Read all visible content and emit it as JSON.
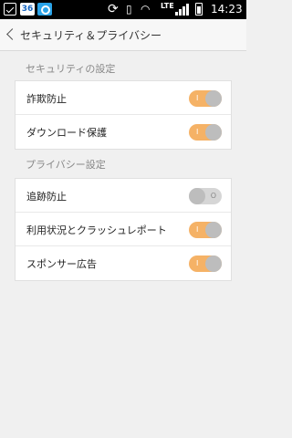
{
  "statusbar": {
    "badge": "36",
    "network": "LTE",
    "time": "14:23"
  },
  "appbar": {
    "title": "セキュリティ＆プライバシー"
  },
  "sections": [
    {
      "header": "セキュリティの設定",
      "items": [
        {
          "label": "詐欺防止",
          "enabled": true
        },
        {
          "label": "ダウンロード保護",
          "enabled": true
        }
      ]
    },
    {
      "header": "プライバシー設定",
      "items": [
        {
          "label": "追跡防止",
          "enabled": false
        },
        {
          "label": "利用状況とクラッシュレポート",
          "enabled": true
        },
        {
          "label": "スポンサー広告",
          "enabled": true
        }
      ]
    }
  ],
  "toggle_marks": {
    "on": "I",
    "off": "O"
  },
  "colors": {
    "toggle_on": "#f5b266",
    "toggle_off": "#d6d6d6"
  }
}
